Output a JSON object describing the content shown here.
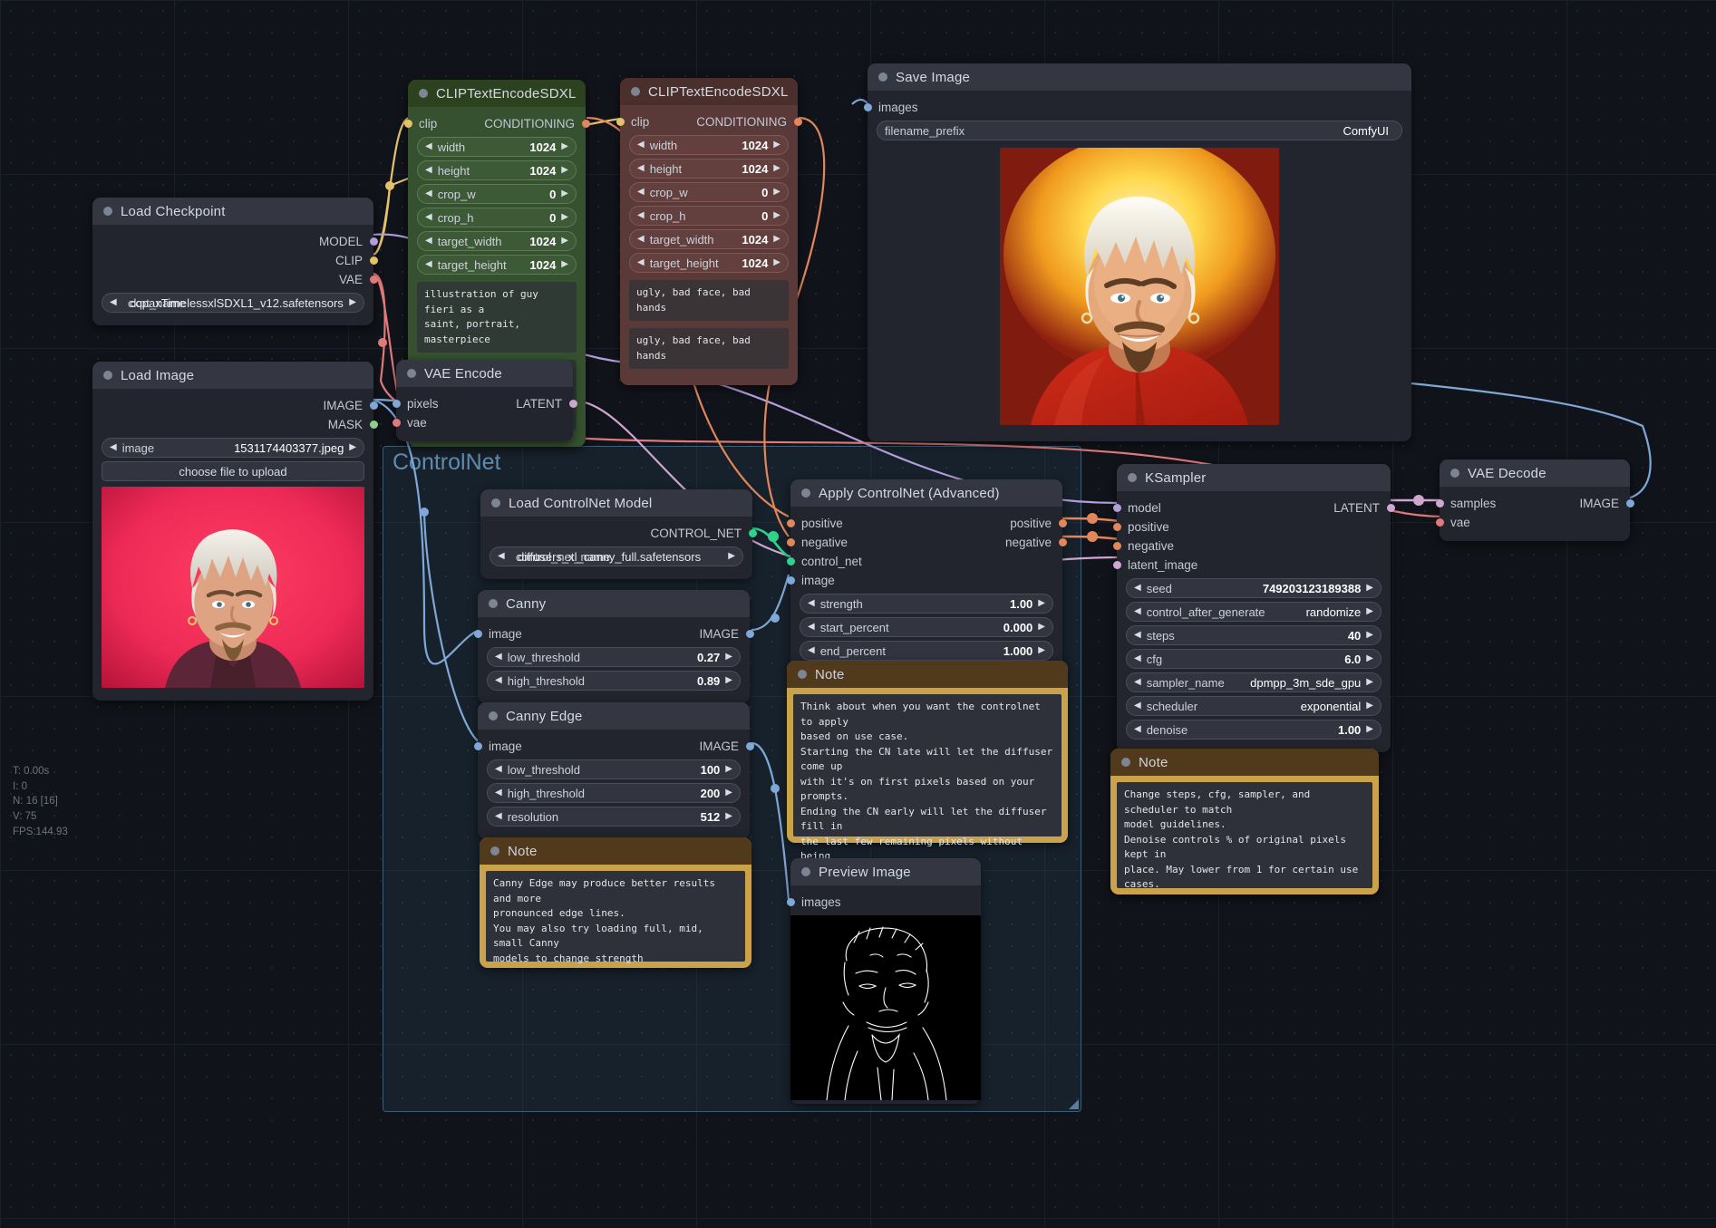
{
  "app": {
    "name": "ComfyUI"
  },
  "stats": {
    "time": "T: 0.00s",
    "iterations": "I: 0",
    "nodes": "N: 16 [16]",
    "vertices": "V: 75",
    "fps": "FPS:144.93"
  },
  "group": {
    "title": "ControlNet"
  },
  "nodes": {
    "load_checkpoint": {
      "title": "Load Checkpoint",
      "outputs": [
        {
          "label": "MODEL",
          "color": "#b39ddb"
        },
        {
          "label": "CLIP",
          "color": "#e3c26a"
        },
        {
          "label": "VAE",
          "color": "#e07a7a"
        }
      ],
      "widgets": [
        {
          "name": "ckpt_name",
          "value": "copaxTimelessxlSDXL1_v12.safetensors",
          "type": "combo"
        }
      ]
    },
    "load_image": {
      "title": "Load Image",
      "outputs": [
        {
          "label": "IMAGE",
          "color": "#7fa8d6"
        },
        {
          "label": "MASK",
          "color": "#8fce8f"
        }
      ],
      "widgets": [
        {
          "name": "image",
          "value": "1531174403377.jpeg",
          "type": "combo"
        },
        {
          "name": "choose file to upload",
          "value": "",
          "type": "button"
        }
      ]
    },
    "clip_positive": {
      "title": "CLIPTextEncodeSDXL",
      "color": "green",
      "inputs": [
        {
          "label": "clip",
          "color": "#e3c26a"
        }
      ],
      "outputs": [
        {
          "label": "CONDITIONING",
          "color": "#e0875b"
        }
      ],
      "widgets": [
        {
          "name": "width",
          "value": "1024"
        },
        {
          "name": "height",
          "value": "1024"
        },
        {
          "name": "crop_w",
          "value": "0"
        },
        {
          "name": "crop_h",
          "value": "0"
        },
        {
          "name": "target_width",
          "value": "1024"
        },
        {
          "name": "target_height",
          "value": "1024"
        }
      ],
      "text_g": "illustration of guy fieri as a\nsaint, portrait, masterpiece",
      "text_l": "illustration of guy fieri as a\nsaint, portrait, masterpiece"
    },
    "clip_negative": {
      "title": "CLIPTextEncodeSDXL",
      "color": "red",
      "inputs": [
        {
          "label": "clip",
          "color": "#e3c26a"
        }
      ],
      "outputs": [
        {
          "label": "CONDITIONING",
          "color": "#e0875b"
        }
      ],
      "widgets": [
        {
          "name": "width",
          "value": "1024"
        },
        {
          "name": "height",
          "value": "1024"
        },
        {
          "name": "crop_w",
          "value": "0"
        },
        {
          "name": "crop_h",
          "value": "0"
        },
        {
          "name": "target_width",
          "value": "1024"
        },
        {
          "name": "target_height",
          "value": "1024"
        }
      ],
      "text_g": "ugly, bad face, bad hands",
      "text_l": "ugly, bad face, bad hands"
    },
    "save_image": {
      "title": "Save Image",
      "inputs": [
        {
          "label": "images",
          "color": "#7fa8d6"
        }
      ],
      "widgets": [
        {
          "name": "filename_prefix",
          "value": "ComfyUI",
          "type": "text"
        }
      ]
    },
    "vae_encode": {
      "title": "VAE Encode",
      "inputs": [
        {
          "label": "pixels",
          "color": "#7fa8d6"
        },
        {
          "label": "vae",
          "color": "#e07a7a"
        }
      ],
      "outputs": [
        {
          "label": "LATENT",
          "color": "#cfa6cf"
        }
      ]
    },
    "load_controlnet": {
      "title": "Load ControlNet Model",
      "outputs": [
        {
          "label": "CONTROL_NET",
          "color": "#2fd18b"
        }
      ],
      "widgets": [
        {
          "name": "control_net_name",
          "value": "diffusers_xl_canny_full.safetensors",
          "type": "combo"
        }
      ]
    },
    "apply_controlnet": {
      "title": "Apply ControlNet (Advanced)",
      "inputs": [
        {
          "label": "positive",
          "color": "#e0875b"
        },
        {
          "label": "negative",
          "color": "#e0875b"
        },
        {
          "label": "control_net",
          "color": "#2fd18b"
        },
        {
          "label": "image",
          "color": "#7fa8d6"
        }
      ],
      "outputs": [
        {
          "label": "positive",
          "color": "#e0875b"
        },
        {
          "label": "negative",
          "color": "#e0875b"
        }
      ],
      "widgets": [
        {
          "name": "strength",
          "value": "1.00"
        },
        {
          "name": "start_percent",
          "value": "0.000"
        },
        {
          "name": "end_percent",
          "value": "1.000"
        }
      ]
    },
    "canny": {
      "title": "Canny",
      "inputs": [
        {
          "label": "image",
          "color": "#7fa8d6"
        }
      ],
      "outputs": [
        {
          "label": "IMAGE",
          "color": "#7fa8d6"
        }
      ],
      "widgets": [
        {
          "name": "low_threshold",
          "value": "0.27"
        },
        {
          "name": "high_threshold",
          "value": "0.89"
        }
      ]
    },
    "canny_edge": {
      "title": "Canny Edge",
      "inputs": [
        {
          "label": "image",
          "color": "#7fa8d6"
        }
      ],
      "outputs": [
        {
          "label": "IMAGE",
          "color": "#7fa8d6"
        }
      ],
      "widgets": [
        {
          "name": "low_threshold",
          "value": "100"
        },
        {
          "name": "high_threshold",
          "value": "200"
        },
        {
          "name": "resolution",
          "value": "512"
        }
      ]
    },
    "ksampler": {
      "title": "KSampler",
      "inputs": [
        {
          "label": "model",
          "color": "#b39ddb"
        },
        {
          "label": "positive",
          "color": "#e0875b"
        },
        {
          "label": "negative",
          "color": "#e0875b"
        },
        {
          "label": "latent_image",
          "color": "#cfa6cf"
        }
      ],
      "outputs": [
        {
          "label": "LATENT",
          "color": "#cfa6cf"
        }
      ],
      "widgets": [
        {
          "name": "seed",
          "value": "749203123189388"
        },
        {
          "name": "control_after_generate",
          "value": "randomize"
        },
        {
          "name": "steps",
          "value": "40"
        },
        {
          "name": "cfg",
          "value": "6.0"
        },
        {
          "name": "sampler_name",
          "value": "dpmpp_3m_sde_gpu"
        },
        {
          "name": "scheduler",
          "value": "exponential"
        },
        {
          "name": "denoise",
          "value": "1.00"
        }
      ]
    },
    "vae_decode": {
      "title": "VAE Decode",
      "inputs": [
        {
          "label": "samples",
          "color": "#cfa6cf"
        },
        {
          "label": "vae",
          "color": "#e07a7a"
        }
      ],
      "outputs": [
        {
          "label": "IMAGE",
          "color": "#7fa8d6"
        }
      ]
    },
    "preview_image": {
      "title": "Preview Image",
      "inputs": [
        {
          "label": "images",
          "color": "#7fa8d6"
        }
      ]
    },
    "note_controlnet": {
      "title": "Note",
      "text": "Think about when you want the controlnet to apply\nbased on use case.\nStarting the CN late will let the diffuser come up\nwith it's on first pixels based on your prompts.\nEnding the CN early will let the diffuser fill in\nthe last few remaining pixels without being\ninfluenced by CN"
    },
    "note_ksampler": {
      "title": "Note",
      "text": "Change steps, cfg, sampler, and scheduler to match\nmodel guidelines.\nDenoise controls % of original pixels kept in\nplace. May lower from 1 for certain use cases."
    },
    "note_canny": {
      "title": "Note",
      "text": "Canny Edge may produce better results and more\npronounced edge lines.\nYou may also try loading full, mid, small Canny\nmodels to change strength"
    }
  }
}
